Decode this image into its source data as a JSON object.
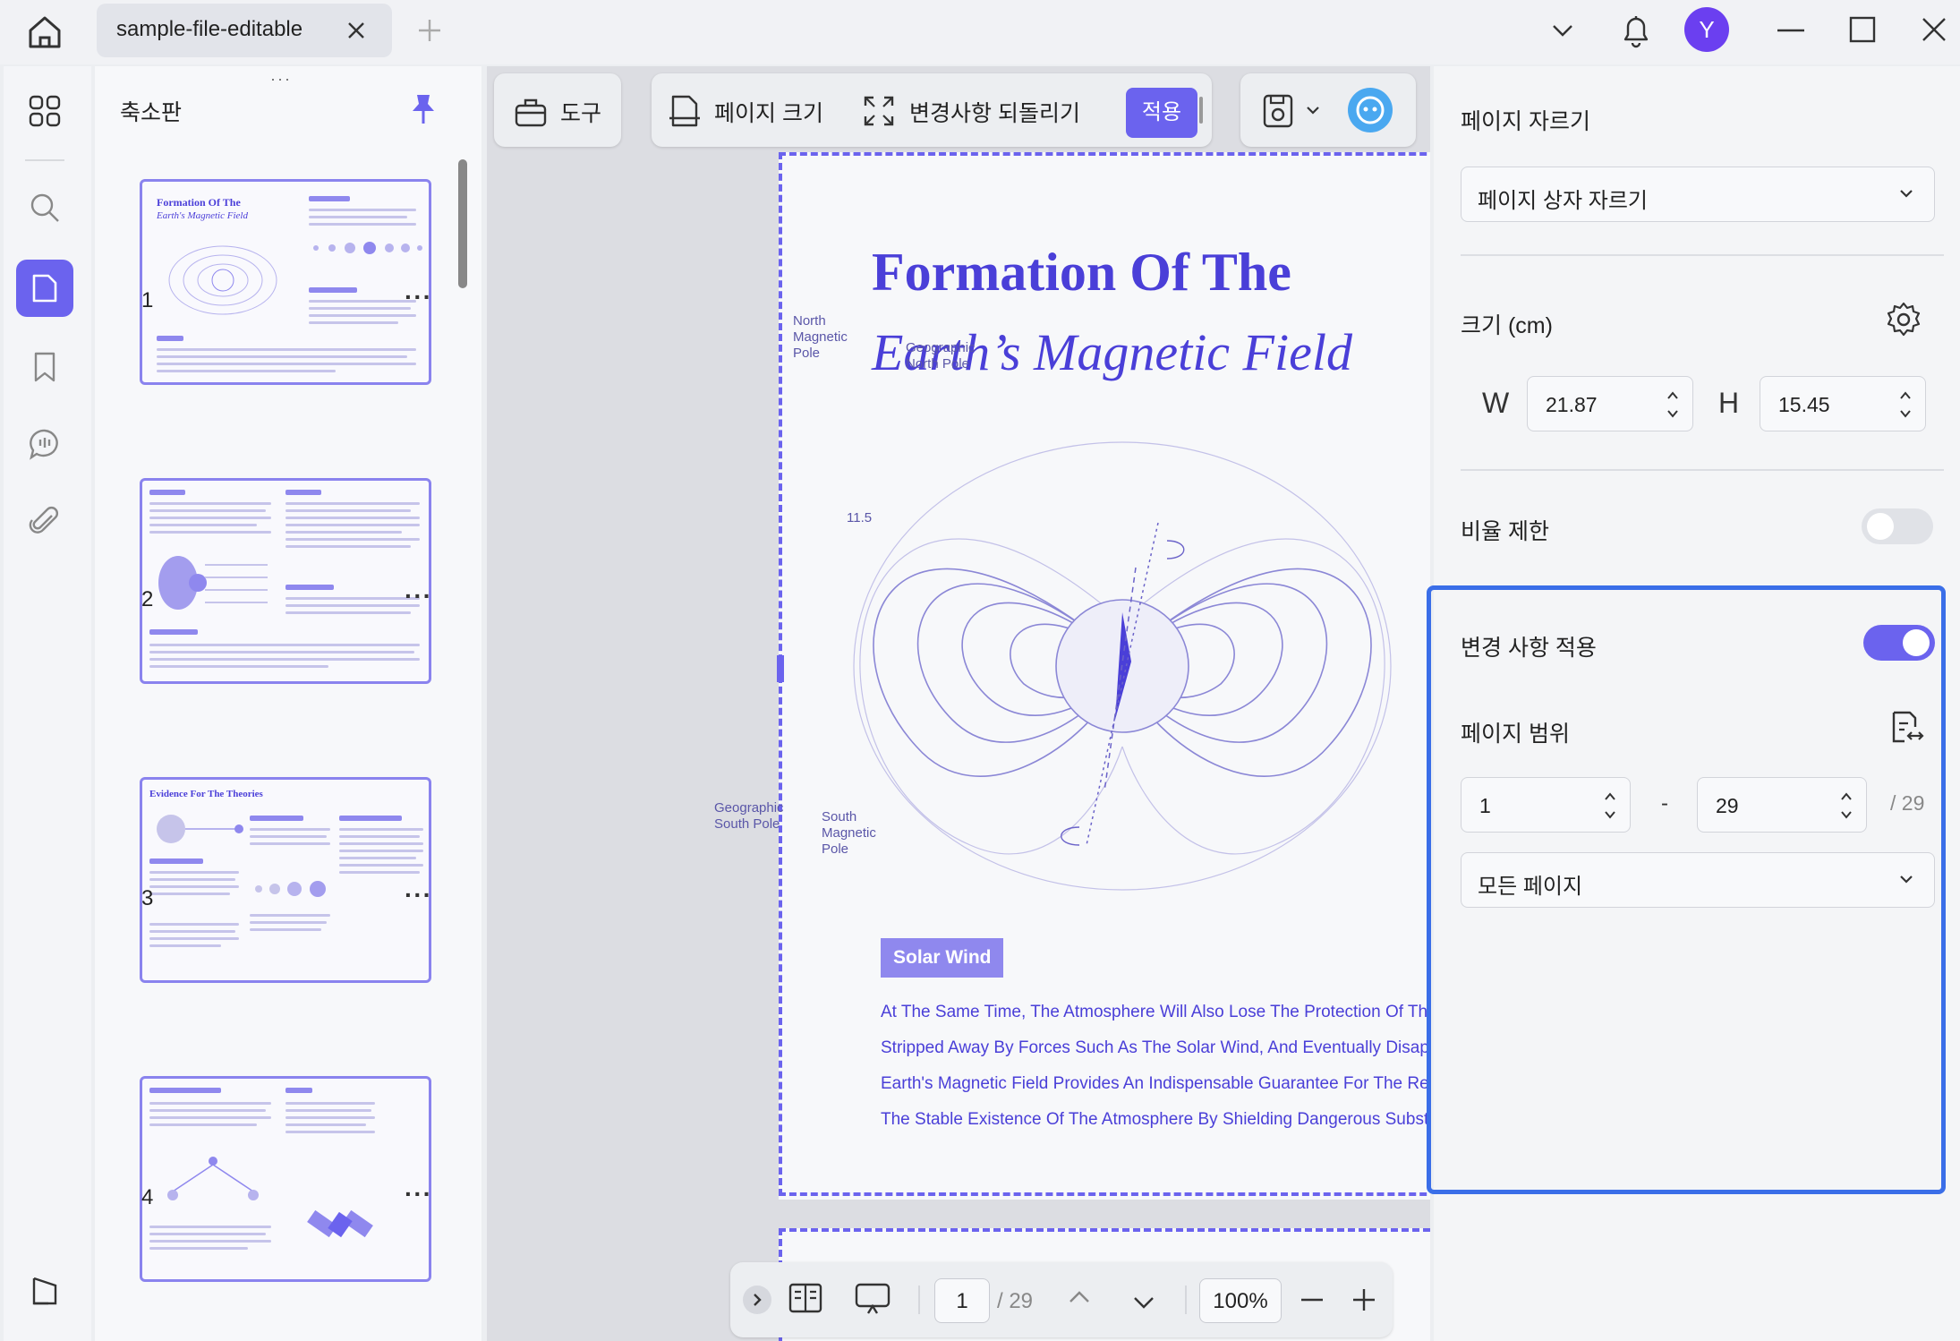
{
  "titlebar": {
    "tab_title": "sample-file-editable",
    "avatar_letter": "Y"
  },
  "thumbnails": {
    "title": "축소판",
    "pages": [
      {
        "number": "1",
        "title": "Formation Of The",
        "subtitle": "Earth's Magnetic Field"
      },
      {
        "number": "2"
      },
      {
        "number": "3",
        "title": "Evidence For The Theories"
      },
      {
        "number": "4"
      }
    ],
    "more_label": "···"
  },
  "toolbar": {
    "tools_label": "도구",
    "page_size_label": "페이지 크기",
    "revert_label": "변경사항 되돌리기",
    "apply_label": "적용"
  },
  "document": {
    "title": "Formation Of The",
    "subtitle": "Earth’s Magnetic Field",
    "diagram_labels": {
      "north_magnetic": "North Magnetic Pole",
      "geo_north": "Geographic North Pole",
      "angle": "11.5",
      "geo_south": "Geographic South Pole",
      "south_magnetic": "South Magnetic Pole"
    },
    "section_badge": "Solar Wind",
    "body_lines": [
      "At The Same Time, The Atmosphere Will Also Lose The Protection Of The",
      "Stripped Away By Forces Such As The Solar Wind, And Eventually Disapp",
      "Earth's Magnetic Field Provides An Indispensable Guarantee For The Rep",
      "The Stable Existence Of The Atmosphere By Shielding Dangerous Substa"
    ]
  },
  "navbar": {
    "current_page": "1",
    "total_pages": "/ 29",
    "zoom": "100%"
  },
  "crop_panel": {
    "crop_title": "페이지 자르기",
    "crop_mode": "페이지 상자 자르기",
    "size_label": "크기 (cm)",
    "width_label": "W",
    "width_value": "21.87",
    "height_label": "H",
    "height_value": "15.45",
    "ratio_label": "비율 제한",
    "ratio_on": false,
    "apply_changes_label": "변경 사항 적용",
    "apply_changes_on": true,
    "range_label": "페이지 범위",
    "range_from": "1",
    "range_dash": "-",
    "range_to": "29",
    "range_total": "/ 29",
    "page_filter": "모든 페이지"
  },
  "colors": {
    "accent": "#6b63ee",
    "highlight": "#3a6ee8",
    "doc_text": "#4a3fd8"
  }
}
